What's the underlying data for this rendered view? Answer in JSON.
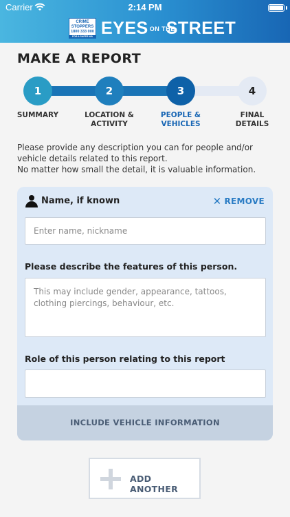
{
  "status_bar": {
    "carrier": "Carrier",
    "time": "2:14 PM"
  },
  "brand": {
    "badge_line1": "CRIME",
    "badge_line2": "STOPPERS",
    "badge_phone": "1800 333 000",
    "badge_tag": "FOR A SAFER WA",
    "title_left": "EYES",
    "title_small": "ON THE",
    "title_right": "STREET",
    "gradient_colors": [
      "#4ab6e0",
      "#2a90d1",
      "#1866b4"
    ]
  },
  "page_title": "MAKE A REPORT",
  "steps": [
    {
      "number": "1",
      "label": "SUMMARY",
      "state": "done"
    },
    {
      "number": "2",
      "label": "LOCATION &\nACTIVITY",
      "state": "done"
    },
    {
      "number": "3",
      "label": "PEOPLE &\nVEHICLES",
      "state": "active"
    },
    {
      "number": "4",
      "label": "FINAL\nDETAILS",
      "state": "todo"
    }
  ],
  "intro": {
    "line1": "Please provide any description you can for people and/or vehicle details related to this report.",
    "line2": "No matter how small the detail, it is valuable information."
  },
  "person_card": {
    "heading": "Name, if known",
    "remove_label": "REMOVE",
    "name_placeholder": "Enter name, nickname",
    "name_value": "",
    "description_label": "Please describe the features of this person.",
    "description_placeholder": "This may include gender, appearance, tattoos, clothing piercings, behaviour, etc.",
    "description_value": "",
    "role_label": "Role of this person relating to this report",
    "role_value": "",
    "vehicle_button": "INCLUDE VEHICLE INFORMATION"
  },
  "add_another_label": "ADD ANOTHER",
  "colors": {
    "accent": "#1866b4",
    "card_background": "#dde9f7",
    "remove": "#2a7cc4"
  }
}
